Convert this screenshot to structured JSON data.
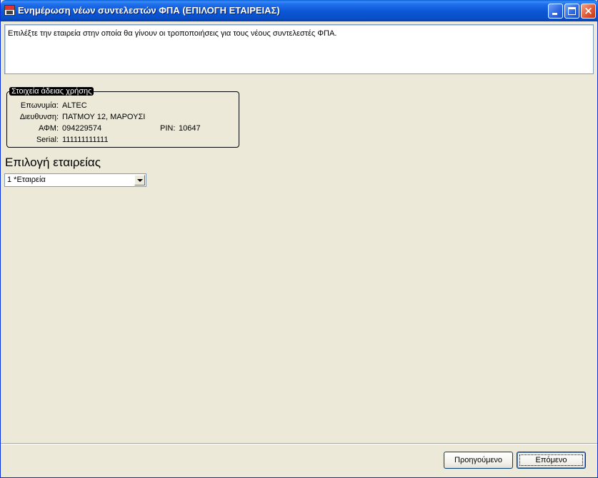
{
  "window": {
    "title": "Ενημέρωση νέων συντελεστών ΦΠΑ (ΕΠΙΛΟΓΗ ΕΤΑΙΡΕΙΑΣ)",
    "icon": "app-icon",
    "controls": {
      "minimize": "minimize-icon",
      "maximize": "maximize-icon",
      "close": "×"
    }
  },
  "instruction": "Επιλέξτε την εταιρεία στην οποία θα γίνουν οι τροποποιήσεις για τους νέους συντελεστές ΦΠΑ.",
  "license": {
    "legend": "Στοιχεία άδειας χρήσης",
    "company_label": "Επωνυμία:",
    "company_value": "ALTEC",
    "address_label": "Διευθυνση:",
    "address_value": "ΠΑΤΜΟΥ 12, ΜΑΡΟΥΣΙ",
    "afm_label": "ΑΦΜ:",
    "afm_value": "094229574",
    "pin_label": "PIN:",
    "pin_value": "10647",
    "serial_label": "Serial:",
    "serial_value": "111111111111"
  },
  "selection": {
    "title": "Επιλογή εταιρείας",
    "selected": "1  *Εταιρεία"
  },
  "buttons": {
    "previous": "Προηγούμενο",
    "next": "Επόμενο"
  }
}
